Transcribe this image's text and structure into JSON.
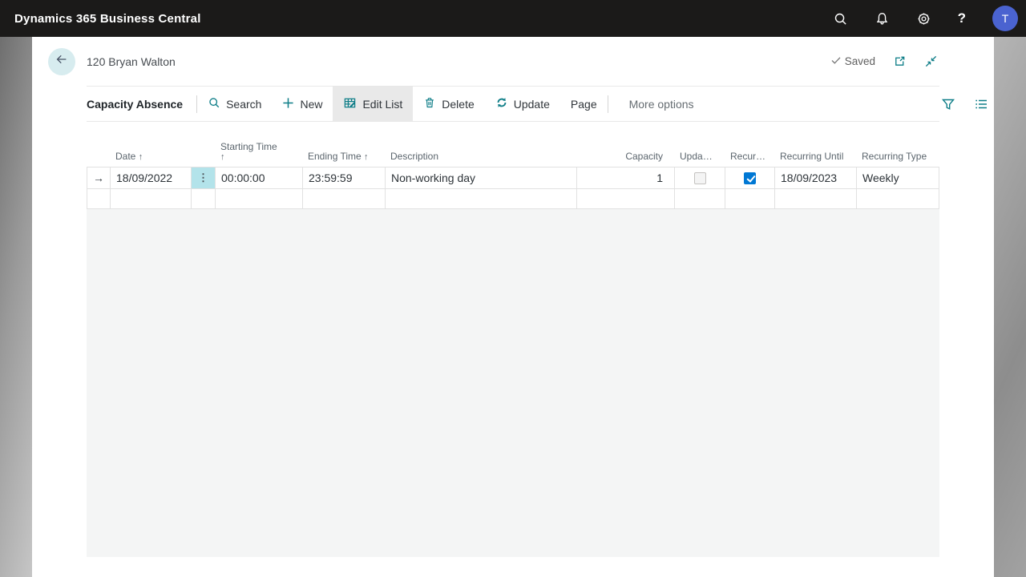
{
  "topbar": {
    "title": "Dynamics 365 Business Central",
    "help_label": "?",
    "avatar_initial": "T"
  },
  "page_header": {
    "title": "120 Bryan Walton",
    "saved_label": "Saved"
  },
  "toolbar": {
    "caption": "Capacity Absence",
    "search_label": "Search",
    "new_label": "New",
    "edit_list_label": "Edit List",
    "delete_label": "Delete",
    "update_label": "Update",
    "page_label": "Page",
    "more_options_label": "More options"
  },
  "table": {
    "sort_asc_icon": "↑",
    "row_indicator_icon": "→",
    "cell_menu_icon": "⋮",
    "headers": {
      "date": "Date",
      "starting_time": "Starting Time",
      "ending_time": "Ending Time",
      "description": "Description",
      "capacity": "Capacity",
      "update_abbrev": "Upda…",
      "recurring_abbrev": "Recur…",
      "recurring_until": "Recurring Until",
      "recurring_type": "Recurring Type"
    },
    "rows": [
      {
        "date": "18/09/2022",
        "starting_time": "00:00:00",
        "ending_time": "23:59:59",
        "description": "Non-working day",
        "capacity": "1",
        "update_checked": false,
        "recurring_checked": true,
        "recurring_until": "18/09/2023",
        "recurring_type": "Weekly"
      }
    ]
  },
  "colors": {
    "accent_teal": "#0d7d87",
    "checkbox_checked_blue": "#0078d4",
    "avatar_blue": "#4a63d0",
    "selected_cell_cyan": "#b3e3ea",
    "topbar_bg": "#1b1a19"
  }
}
